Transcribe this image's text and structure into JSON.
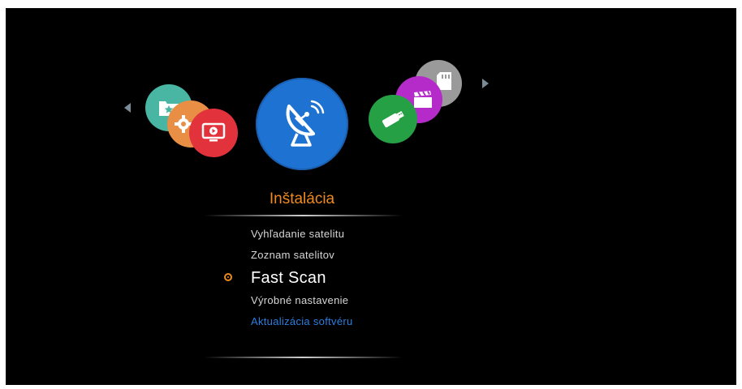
{
  "menu": {
    "title": "Inštalácia",
    "items": [
      {
        "label": "Vyhľadanie satelitu"
      },
      {
        "label": "Zoznam satelitov"
      },
      {
        "label": "Fast Scan"
      },
      {
        "label": "Výrobné nastavenie"
      },
      {
        "label": "Aktualizácia softvéru"
      }
    ],
    "selected_index": 2
  },
  "carousel": {
    "center_icon": "satellite-dish-icon",
    "left_icons": [
      "folder-star-icon",
      "gear-icon",
      "tv-play-icon"
    ],
    "right_icons": [
      "usb-icon",
      "video-clapper-icon",
      "sd-card-icon"
    ]
  },
  "colors": {
    "accent": "#ee8a1f",
    "center_circle": "#1e73d2",
    "link": "#2c7fe0",
    "folder": "#48b6a2",
    "gear": "#e98e45",
    "tv": "#e2323c",
    "usb": "#26a045",
    "video": "#b52bc9",
    "sd": "#9a9a9a"
  }
}
